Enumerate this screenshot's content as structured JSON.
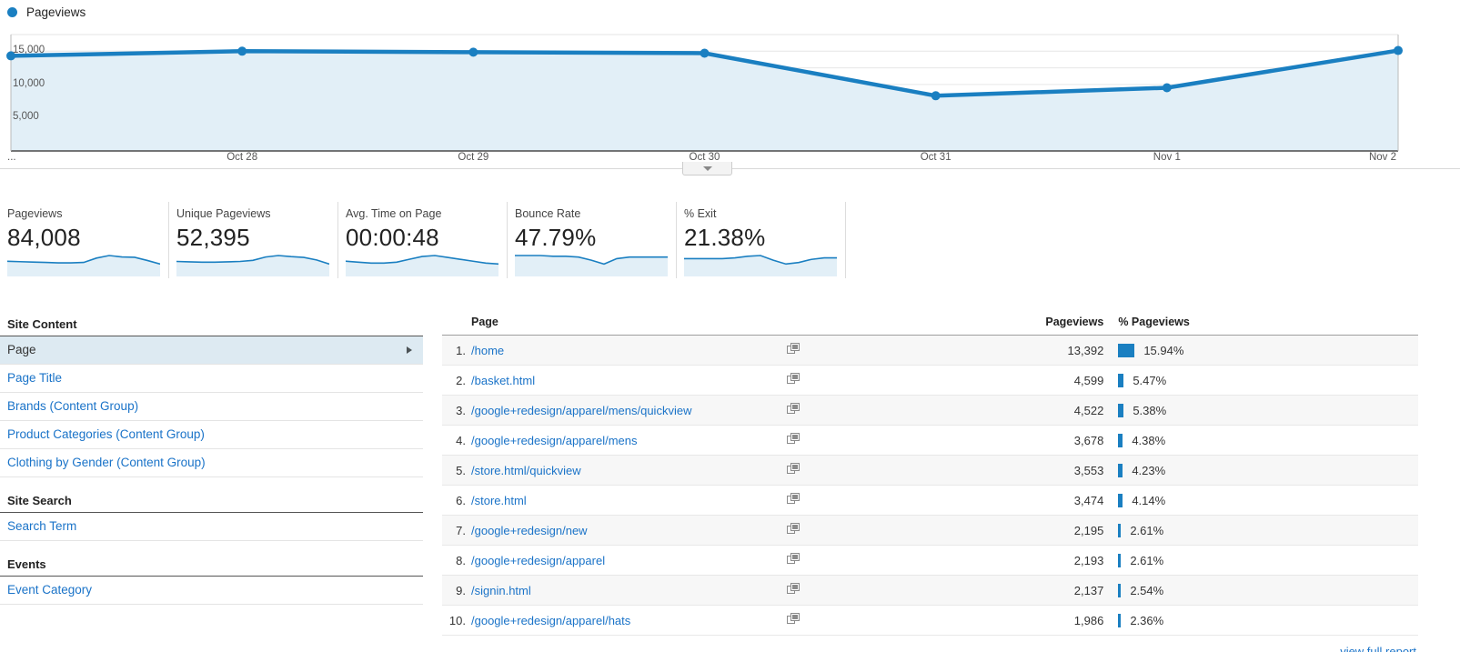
{
  "legend": {
    "series_label": "Pageviews",
    "color": "#1a7fc1"
  },
  "chart_data": {
    "type": "area",
    "title": "Pageviews",
    "xlabel": "",
    "ylabel": "",
    "categories": [
      "...",
      "Oct 28",
      "Oct 29",
      "Oct 30",
      "Oct 31",
      "Nov 1",
      "Nov 2"
    ],
    "values": [
      14300,
      15000,
      14850,
      14700,
      8300,
      9500,
      15100
    ],
    "ylim": [
      0,
      17500
    ],
    "yticks": [
      5000,
      10000,
      15000
    ],
    "ytick_labels": [
      "5,000",
      "10,000",
      "15,000"
    ],
    "grid": true,
    "legend_position": "top-left",
    "line_color": "#1a7fc1",
    "fill_color": "#e2eff7"
  },
  "collapse_toggle": {
    "icon": "chevron-down-icon"
  },
  "metrics": [
    {
      "label": "Pageviews",
      "value": "84,008",
      "spark": [
        66,
        64,
        62,
        60,
        58,
        58,
        60,
        82,
        95,
        88,
        86,
        70,
        52
      ]
    },
    {
      "label": "Unique Pageviews",
      "value": "52,395",
      "spark": [
        64,
        62,
        60,
        60,
        62,
        64,
        70,
        88,
        96,
        90,
        86,
        72,
        50
      ]
    },
    {
      "label": "Avg. Time on Page",
      "value": "00:00:48",
      "spark": [
        62,
        60,
        58,
        58,
        60,
        66,
        72,
        74,
        70,
        66,
        62,
        58,
        56
      ]
    },
    {
      "label": "Bounce Rate",
      "value": "47.79%",
      "spark": [
        70,
        70,
        70,
        68,
        68,
        66,
        58,
        48,
        62,
        66,
        66,
        66,
        66
      ]
    },
    {
      "label": "% Exit",
      "value": "21.38%",
      "spark": [
        64,
        64,
        64,
        64,
        66,
        70,
        72,
        60,
        50,
        54,
        62,
        66,
        66
      ]
    }
  ],
  "sidebar": {
    "groups": [
      {
        "title": "Site Content",
        "items": [
          {
            "label": "Page",
            "selected": true,
            "has_arrow": true
          },
          {
            "label": "Page Title",
            "selected": false,
            "has_arrow": false
          },
          {
            "label": "Brands (Content Group)",
            "selected": false,
            "has_arrow": false
          },
          {
            "label": "Product Categories (Content Group)",
            "selected": false,
            "has_arrow": false
          },
          {
            "label": "Clothing by Gender (Content Group)",
            "selected": false,
            "has_arrow": false
          }
        ]
      },
      {
        "title": "Site Search",
        "items": [
          {
            "label": "Search Term",
            "selected": false,
            "has_arrow": false
          }
        ]
      },
      {
        "title": "Events",
        "items": [
          {
            "label": "Event Category",
            "selected": false,
            "has_arrow": false
          }
        ]
      }
    ]
  },
  "table": {
    "columns": {
      "page": "Page",
      "pageviews": "Pageviews",
      "pct_pageviews": "% Pageviews"
    },
    "row_icon": "open-in-new-window-icon",
    "max_pct": 15.94,
    "rows": [
      {
        "index": "1.",
        "page": "/home",
        "pageviews": "13,392",
        "pct": "15.94%",
        "pct_value": 15.94
      },
      {
        "index": "2.",
        "page": "/basket.html",
        "pageviews": "4,599",
        "pct": "5.47%",
        "pct_value": 5.47
      },
      {
        "index": "3.",
        "page": "/google+redesign/apparel/mens/quickview",
        "pageviews": "4,522",
        "pct": "5.38%",
        "pct_value": 5.38
      },
      {
        "index": "4.",
        "page": "/google+redesign/apparel/mens",
        "pageviews": "3,678",
        "pct": "4.38%",
        "pct_value": 4.38
      },
      {
        "index": "5.",
        "page": "/store.html/quickview",
        "pageviews": "3,553",
        "pct": "4.23%",
        "pct_value": 4.23
      },
      {
        "index": "6.",
        "page": "/store.html",
        "pageviews": "3,474",
        "pct": "4.14%",
        "pct_value": 4.14
      },
      {
        "index": "7.",
        "page": "/google+redesign/new",
        "pageviews": "2,195",
        "pct": "2.61%",
        "pct_value": 2.61
      },
      {
        "index": "8.",
        "page": "/google+redesign/apparel",
        "pageviews": "2,193",
        "pct": "2.61%",
        "pct_value": 2.61
      },
      {
        "index": "9.",
        "page": "/signin.html",
        "pageviews": "2,137",
        "pct": "2.54%",
        "pct_value": 2.54
      },
      {
        "index": "10.",
        "page": "/google+redesign/apparel/hats",
        "pageviews": "1,986",
        "pct": "2.36%",
        "pct_value": 2.36
      }
    ],
    "footer_link": "view full report"
  }
}
